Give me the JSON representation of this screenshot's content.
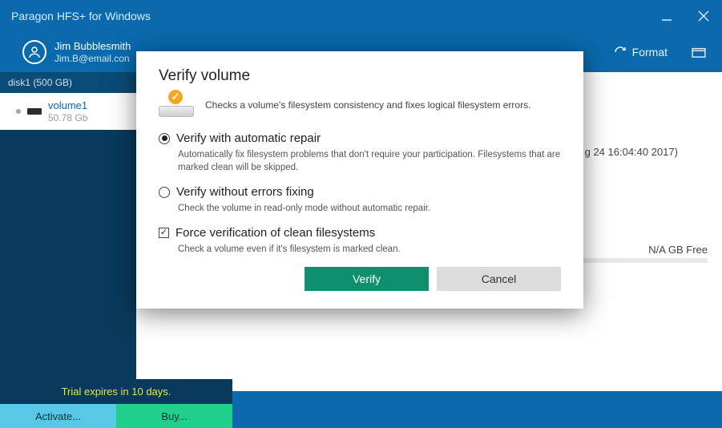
{
  "titlebar": {
    "title": "Paragon HFS+ for Windows"
  },
  "user": {
    "name": "Jim Bubblesmith",
    "email": "Jim.B@email.con"
  },
  "header_actions": {
    "format": "Format"
  },
  "sidebar": {
    "disk_label": "disk1 (500 GB)",
    "volume": {
      "name": "volume1",
      "size": "50.78 Gb"
    },
    "trial_text": "Trial expires in 10 days.",
    "activate": "Activate...",
    "buy": "Buy..."
  },
  "content": {
    "date_fragment": "g 24 16:04:40 2017)",
    "free_label": "N/A GB Free"
  },
  "dialog": {
    "title": "Verify volume",
    "desc": "Checks a volume's filesystem consistency and fixes logical filesystem errors.",
    "opt1_label": "Verify with automatic repair",
    "opt1_sub": "Automatically fix filesystem problems that don't require your participation. Filesystems that are marked clean will be skipped.",
    "opt2_label": "Verify without errors fixing",
    "opt2_sub": "Check the volume in read-only mode without automatic repair.",
    "opt3_label": "Force verification of clean filesystems",
    "opt3_sub": "Check a volume even if it's filesystem is marked clean.",
    "verify": "Verify",
    "cancel": "Cancel"
  }
}
